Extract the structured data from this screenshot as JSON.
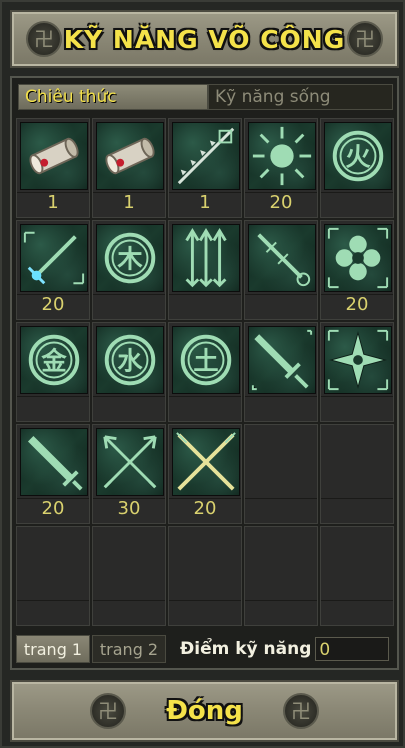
{
  "window": {
    "title": "KỸ NĂNG VÕ CÔNG",
    "emblem_glyph": "卍"
  },
  "tabs": [
    {
      "label": "Chiêu thức",
      "active": true
    },
    {
      "label": "Kỹ năng sống",
      "active": false
    }
  ],
  "skills": [
    {
      "icon": "scroll-icon",
      "level": "1"
    },
    {
      "icon": "scroll-icon",
      "level": "1"
    },
    {
      "icon": "arrow-volley-icon",
      "level": "1"
    },
    {
      "icon": "radiant-orb-icon",
      "level": "20"
    },
    {
      "icon": "fire-element-icon",
      "glyph": "火",
      "level": ""
    },
    {
      "icon": "sword-strike-icon",
      "level": "20"
    },
    {
      "icon": "wood-element-icon",
      "glyph": "木",
      "level": ""
    },
    {
      "icon": "triple-arrow-icon",
      "level": ""
    },
    {
      "icon": "spiked-sword-icon",
      "level": ""
    },
    {
      "icon": "quatrefoil-icon",
      "level": "20"
    },
    {
      "icon": "metal-element-icon",
      "glyph": "金",
      "level": ""
    },
    {
      "icon": "water-element-icon",
      "glyph": "水",
      "level": ""
    },
    {
      "icon": "earth-element-icon",
      "glyph": "土",
      "level": ""
    },
    {
      "icon": "green-sword-icon",
      "level": ""
    },
    {
      "icon": "shuriken-icon",
      "level": ""
    },
    {
      "icon": "broad-blade-icon",
      "level": "20"
    },
    {
      "icon": "crossed-arrows-icon",
      "level": "30"
    },
    {
      "icon": "crossed-spears-icon",
      "level": "20"
    }
  ],
  "footer": {
    "page_tabs": [
      {
        "label": "trang 1",
        "active": true
      },
      {
        "label": "trang 2",
        "active": false
      }
    ],
    "skill_points_label": "Điểm kỹ năng",
    "skill_points_value": "0"
  },
  "close_button": {
    "label": "Đóng"
  },
  "colors": {
    "title_text": "#f4e24a",
    "icon_green": "#9fdcb4",
    "level_text": "#d9d16e"
  }
}
